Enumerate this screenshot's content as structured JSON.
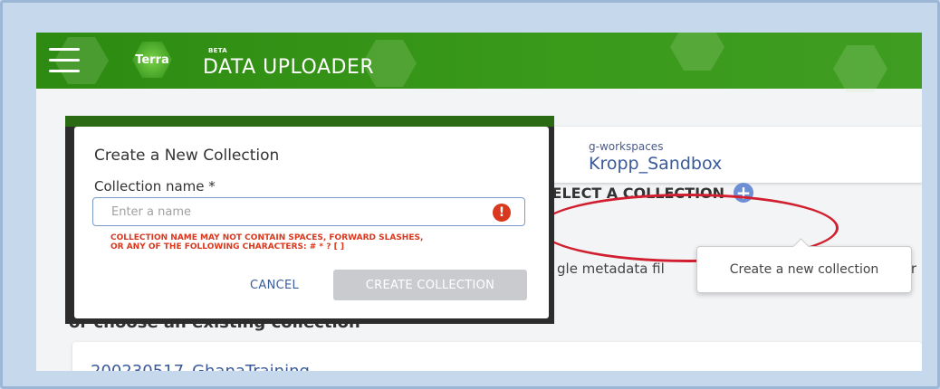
{
  "header": {
    "menu_icon": "hamburger-icon",
    "logo_text": "Terra",
    "beta": "BETA",
    "title": "DATA UPLOADER"
  },
  "workspace": {
    "namespace_partial": "g-workspaces",
    "name_partial": "Kropp_Sandbox"
  },
  "select_collection": {
    "label": "SELECT A COLLECTION",
    "add_icon": "plus-circle-icon",
    "tooltip": "Create a new collection"
  },
  "body_text": {
    "metadata_partial": "gle metadata fil",
    "metadata_tail": "tr",
    "choose_existing": "or choose an existing collection",
    "existing_collection": "200230517_GhanaTraining"
  },
  "modal": {
    "title": "Create a New Collection",
    "field_label": "Collection name *",
    "placeholder": "Enter a name",
    "error_icon": "exclamation-icon",
    "error": "COLLECTION NAME MAY NOT CONTAIN SPACES, FORWARD SLASHES, OR ANY OF THE FOLLOWING CHARACTERS: # * ? [ ]",
    "cancel": "CANCEL",
    "create": "CREATE COLLECTION"
  },
  "colors": {
    "header_green": "#3a9a1a",
    "annotation_red": "#d11f2f",
    "error_red": "#d9381e",
    "link_blue": "#3b5d9a"
  }
}
